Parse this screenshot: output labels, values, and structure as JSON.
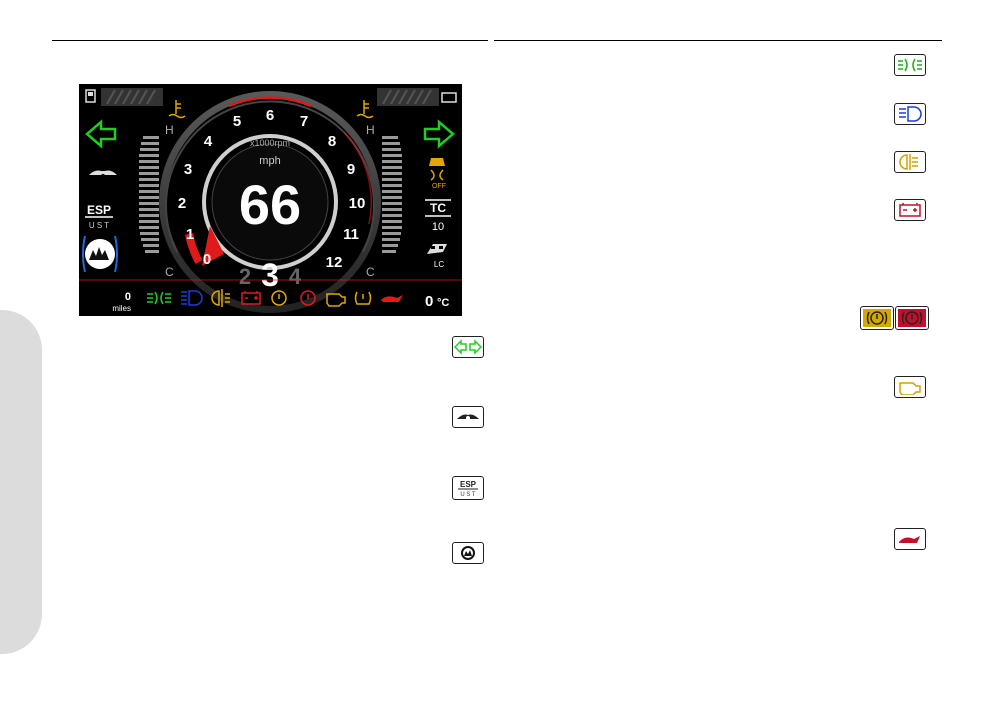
{
  "speed": {
    "value": "66",
    "unit": "mph"
  },
  "tach": {
    "unit": "x1000rpm",
    "ticks": [
      "0",
      "1",
      "2",
      "3",
      "4",
      "5",
      "6",
      "7",
      "8",
      "9",
      "10",
      "11",
      "12"
    ]
  },
  "gear": {
    "prev": "2",
    "current": "3",
    "next": "4"
  },
  "temp_gauge": {
    "hot": "H",
    "cold": "C"
  },
  "odometer": {
    "value": "0",
    "unit": "miles"
  },
  "ambient_temp": {
    "value": "0",
    "unit": "°C"
  },
  "tc": {
    "label": "TC",
    "level": "10"
  },
  "esp": {
    "label": "ESP",
    "modes": "U S T"
  },
  "traction_off": {
    "label": "OFF"
  },
  "launch": {
    "label": "LC"
  },
  "colors": {
    "turn": "#22cc22",
    "high_beam": "#1a3fd8",
    "warning": "#e0a800",
    "alert": "#e01a1a"
  },
  "right_icons": [
    "side-light-icon",
    "high-beam-icon",
    "rear-fog-icon",
    "battery-icon",
    "brake-warning-icon",
    "engine-icon",
    "oil-pressure-icon"
  ],
  "left_icons": [
    "turn-signal-icon",
    "cruise-icon",
    "esp-icon",
    "riding-mode-icon"
  ]
}
